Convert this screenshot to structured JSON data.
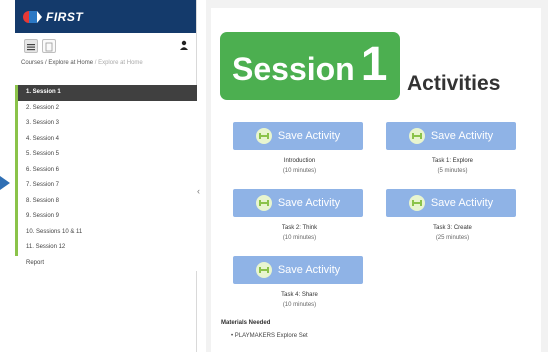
{
  "brand": {
    "logo_text": "FIRST"
  },
  "breadcrumb": {
    "courses": "Courses",
    "sep1": " / ",
    "explore_home": "Explore at Home",
    "sep2": " / ",
    "current": "Explore at Home"
  },
  "nav": {
    "items": [
      {
        "label": "1. Session 1",
        "active": true
      },
      {
        "label": "2. Session 2"
      },
      {
        "label": "3. Session 3"
      },
      {
        "label": "4. Session 4"
      },
      {
        "label": "5. Session 5"
      },
      {
        "label": "6. Session 6"
      },
      {
        "label": "7. Session 7"
      },
      {
        "label": "8. Session 8"
      },
      {
        "label": "9. Session 9"
      },
      {
        "label": "10. Sessions 10 & 11"
      },
      {
        "label": "11. Session 12"
      },
      {
        "label": "Report"
      }
    ]
  },
  "collapse_icon": "‹",
  "header": {
    "session_word": "Session",
    "session_number": "1",
    "activities_title": "Activities"
  },
  "activities": [
    {
      "button": "Save Activity",
      "title": "Introduction",
      "duration": "(10 minutes)"
    },
    {
      "button": "Save Activity",
      "title": "Task 1: Explore",
      "duration": "(5 minutes)"
    },
    {
      "button": "Save Activity",
      "title": "Task 2: Think",
      "duration": "(10 minutes)"
    },
    {
      "button": "Save Activity",
      "title": "Task 3: Create",
      "duration": "(25 minutes)"
    },
    {
      "button": "Save Activity",
      "title": "Task 4: Share",
      "duration": "(10 minutes)"
    }
  ],
  "materials": {
    "heading": "Materials Needed",
    "items": [
      "PLAYMAKERS Explore Set"
    ]
  },
  "colors": {
    "brand_navy": "#143a6b",
    "session_green": "#4caf50",
    "save_button_blue": "#8fb3e6",
    "nav_active": "#404040",
    "nav_accent": "#8bc34a"
  },
  "icons": {
    "logo": "first-logo-icon",
    "list_view": "list-view-icon",
    "doc_view": "document-view-icon",
    "user": "user-icon",
    "save": "save-activity-icon",
    "pointer": "left-arrow-icon"
  }
}
